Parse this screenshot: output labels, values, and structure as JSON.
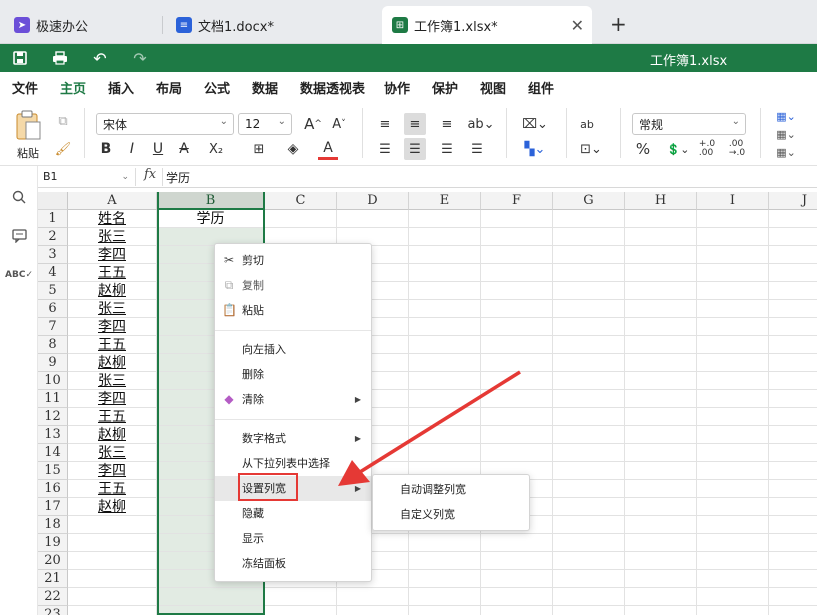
{
  "tabs": [
    {
      "label": "极速办公",
      "icon_color": "#6b4fd8"
    },
    {
      "label": "文档1.docx*",
      "icon_color": "#2b62d9"
    },
    {
      "label": "工作簿1.xlsx*",
      "icon_color": "#1e7a45"
    }
  ],
  "new_tab_label": "+",
  "title": "工作簿1.xlsx",
  "menu": [
    "文件",
    "主页",
    "插入",
    "布局",
    "公式",
    "数据",
    "数据透视表",
    "协作",
    "保护",
    "视图",
    "组件"
  ],
  "ribbon": {
    "paste_label": "粘贴",
    "font_name": "宋体",
    "font_size": "12",
    "number_format": "常规",
    "bold": "B",
    "italic": "I",
    "underline": "U",
    "strike": "A",
    "subscript": "X₂",
    "font_color": "A",
    "percent": "%",
    "inc_decimal": "+.0\n.00",
    "dec_decimal": ".00\n→.0",
    "grow_font": "A^",
    "shrink_font": "A˅"
  },
  "formula": {
    "cell_ref": "B1",
    "fx": "fx",
    "value": "学历"
  },
  "columns": [
    "A",
    "B",
    "C",
    "D",
    "E",
    "F",
    "G",
    "H",
    "I",
    "J"
  ],
  "rows": [
    "1",
    "2",
    "3",
    "4",
    "5",
    "6",
    "7",
    "8",
    "9",
    "10",
    "11",
    "12",
    "13",
    "14",
    "15",
    "16",
    "17",
    "18",
    "19",
    "20",
    "21",
    "22",
    "23"
  ],
  "col_a": [
    "姓名",
    "张三",
    "李四",
    "王五",
    "赵柳",
    "张三",
    "李四",
    "王五",
    "赵柳",
    "张三",
    "李四",
    "王五",
    "赵柳",
    "张三",
    "李四",
    "王五",
    "赵柳"
  ],
  "col_b": [
    "学历"
  ],
  "context_menu": {
    "items": [
      {
        "label": "剪切",
        "icon": "scissors-icon"
      },
      {
        "label": "复制",
        "icon": "copy-icon"
      },
      {
        "label": "粘贴",
        "icon": "paste-icon"
      },
      {
        "label": "向左插入"
      },
      {
        "label": "删除"
      },
      {
        "label": "清除",
        "icon": "eraser-icon",
        "submenu": true
      },
      {
        "label": "数字格式",
        "submenu": true
      },
      {
        "label": "从下拉列表中选择"
      },
      {
        "label": "设置列宽",
        "submenu": true,
        "highlighted": true
      },
      {
        "label": "隐藏"
      },
      {
        "label": "显示"
      },
      {
        "label": "冻结面板"
      }
    ],
    "submenu": [
      "自动调整列宽",
      "自定义列宽"
    ]
  },
  "colors": {
    "accent": "#1e7a45",
    "annotation": "#e53935"
  }
}
